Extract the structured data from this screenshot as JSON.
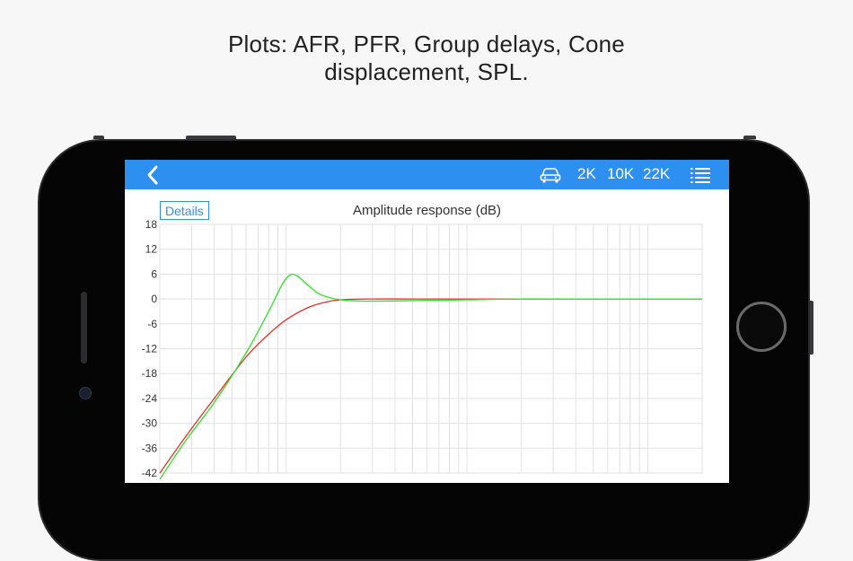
{
  "caption": {
    "line1": "Plots: AFR, PFR, Group delays, Cone",
    "line2": "displacement, SPL."
  },
  "navbar": {
    "back_icon": "chevron-left-icon",
    "car_icon": "car-icon",
    "items": [
      {
        "label": "2K"
      },
      {
        "label": "10K"
      },
      {
        "label": "22K"
      }
    ],
    "list_icon": "list-icon"
  },
  "details_label": "Details",
  "colors": {
    "accent": "#2d8ff0",
    "series_red": "#e8302a",
    "series_green": "#34e02b",
    "grid": "#e2e2e2"
  },
  "chart_data": {
    "type": "line",
    "title": "Amplitude response (dB)",
    "xlabel": "",
    "ylabel": "",
    "x_scale": "log",
    "grid": true,
    "ylim": [
      -42,
      18
    ],
    "yticks": [
      18,
      12,
      6,
      0,
      -6,
      -12,
      -18,
      -24,
      -30,
      -36,
      -42
    ],
    "series": [
      {
        "color": "#e8302a",
        "x": [
          20,
          28,
          40,
          60,
          80,
          100,
          130,
          160,
          200,
          300,
          500,
          1000,
          5000,
          20000
        ],
        "y": [
          -42,
          -33,
          -24,
          -14,
          -8.5,
          -5,
          -2.2,
          -0.9,
          -0.2,
          0,
          0,
          0,
          0,
          0
        ]
      },
      {
        "color": "#34e02b",
        "x": [
          20,
          28,
          40,
          60,
          80,
          95,
          105,
          115,
          130,
          150,
          175,
          200,
          250,
          350,
          500,
          1000,
          2000,
          5000,
          20000
        ],
        "y": [
          -43.5,
          -34,
          -25,
          -13,
          -3,
          3.5,
          5.8,
          5.6,
          3.6,
          1.4,
          0.3,
          -0.2,
          -0.5,
          -0.5,
          -0.4,
          -0.2,
          0,
          0,
          0
        ]
      }
    ]
  }
}
